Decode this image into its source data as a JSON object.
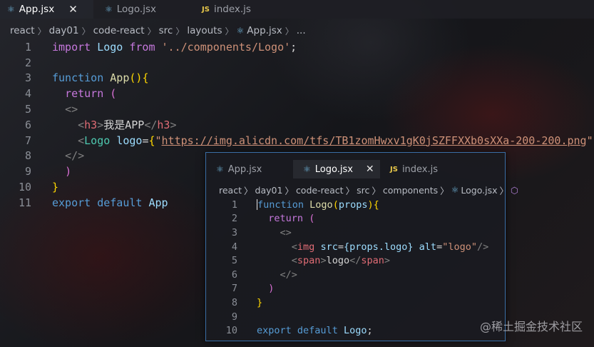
{
  "tabs": [
    {
      "label": "App.jsx",
      "icon": "react-icon",
      "active": true
    },
    {
      "label": "Logo.jsx",
      "icon": "react-icon",
      "active": false
    },
    {
      "label": "index.js",
      "icon": "js-icon",
      "icon_text": "JS",
      "active": false
    }
  ],
  "close_glyph": "✕",
  "breadcrumb": [
    "react",
    "day01",
    "code-react",
    "src",
    "layouts",
    "App.jsx",
    "..."
  ],
  "line_numbers": [
    "1",
    "2",
    "3",
    "4",
    "5",
    "6",
    "7",
    "8",
    "9",
    "10",
    "11"
  ],
  "code": {
    "l1": {
      "k1": "import",
      "id": "Logo",
      "k2": "from",
      "str": "'../components/Logo'",
      "semi": ";"
    },
    "l3": {
      "k": "function",
      "fn": "App",
      "p": "()",
      "b": "{"
    },
    "l4": {
      "k": "return",
      "p": "("
    },
    "l5": {
      "t": "<>"
    },
    "l6": {
      "o": "<",
      "tag": "h3",
      "c": ">",
      "text": "我是APP",
      "e": "</",
      "tag2": "h3",
      "c2": ">"
    },
    "l7": {
      "o": "<",
      "comp": "Logo",
      "attr": "logo",
      "eq": "=",
      "b1": "{",
      "q1": "\"",
      "url": "https://img.alicdn.com/tfs/TB1zomHwxv1gK0jSZFFXXb0sXXa-200-200.png",
      "q2": "\"",
      "b2": "}",
      "end": "/>"
    },
    "l8": {
      "t": "</>"
    },
    "l9": {
      "p": ")"
    },
    "l10": {
      "b": "}"
    },
    "l11": {
      "k1": "export",
      "k2": "default",
      "id": "App"
    }
  },
  "popup": {
    "tabs": [
      {
        "label": "App.jsx",
        "icon": "react-icon",
        "active": false
      },
      {
        "label": "Logo.jsx",
        "icon": "react-icon",
        "active": true
      },
      {
        "label": "index.js",
        "icon": "js-icon",
        "icon_text": "JS",
        "active": false
      }
    ],
    "breadcrumb": [
      "react",
      "day01",
      "code-react",
      "src",
      "components",
      "Logo.jsx"
    ],
    "line_numbers": [
      "1",
      "2",
      "3",
      "4",
      "5",
      "6",
      "7",
      "8",
      "9",
      "10"
    ],
    "code": {
      "l1": {
        "k": "function",
        "fn": "Logo",
        "p1": "(",
        "param": "props",
        "p2": ")",
        "b": "{"
      },
      "l2": {
        "k": "return",
        "p": "("
      },
      "l3": {
        "t": "<>"
      },
      "l4": {
        "o": "<",
        "tag": "img",
        "a1": "src",
        "eq1": "=",
        "v1": "{props.logo}",
        "a2": "alt",
        "eq2": "=",
        "v2": "\"logo\"",
        "end": "/>"
      },
      "l5": {
        "o": "<",
        "tag": "span",
        "c": ">",
        "text": "logo",
        "e": "</",
        "tag2": "span",
        "c2": ">"
      },
      "l6": {
        "t": "</>"
      },
      "l7": {
        "p": ")"
      },
      "l8": {
        "b": "}"
      },
      "l10": {
        "k1": "export",
        "k2": "default",
        "id": "Logo",
        "semi": ";"
      }
    }
  },
  "watermark": "@稀土掘金技术社区"
}
